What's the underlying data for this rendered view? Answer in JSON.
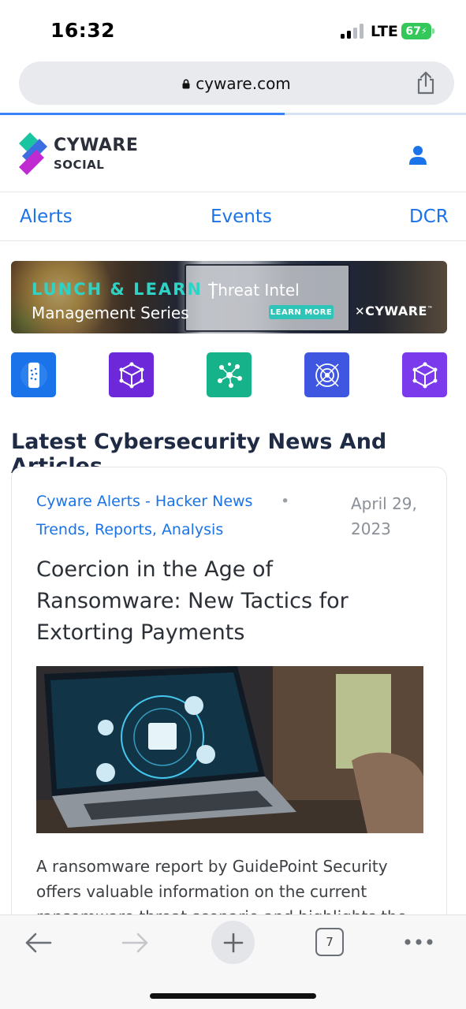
{
  "status_bar": {
    "time": "16:32",
    "network": "LTE",
    "battery": "67"
  },
  "browser": {
    "url": "cyware.com",
    "page_load_progress": 0.61,
    "tab_count": "7"
  },
  "site": {
    "logo_line1": "CYWARE",
    "logo_line2": "SOCIAL"
  },
  "nav": {
    "items": [
      {
        "label": "Alerts"
      },
      {
        "label": "Events"
      },
      {
        "label": "DCR"
      }
    ]
  },
  "banner": {
    "part1": "LUNCH & LEARN",
    "separator": "|",
    "part2": "Threat Intel",
    "part3": "Management Series",
    "button": "LEARN MORE",
    "brand": "CYWARE"
  },
  "app_icons": [
    {
      "icon": "mobile-app-icon",
      "color": "#1a73e8"
    },
    {
      "icon": "cube-network-icon",
      "color": "#6d28d9"
    },
    {
      "icon": "dots-network-icon",
      "color": "#16b38a"
    },
    {
      "icon": "shield-target-icon",
      "color": "#3f57e0"
    },
    {
      "icon": "cube-network-icon",
      "color": "#7c3aed"
    }
  ],
  "section": {
    "title": "Latest Cybersecurity News And Articles"
  },
  "article": {
    "category_1": "Cyware Alerts - Hacker News",
    "category_separator": "•",
    "category_2": "Trends, Reports, Analysis",
    "date": "April 29, 2023",
    "title": "Coercion in the Age of Ransomware: New Tactics for Extorting Payments",
    "excerpt": "A ransomware report by GuidePoint Security offers valuable information on the current ransomware threat scenario and highlights the"
  },
  "colors": {
    "link": "#1a73e8",
    "accent_teal": "#2fd3c6"
  }
}
